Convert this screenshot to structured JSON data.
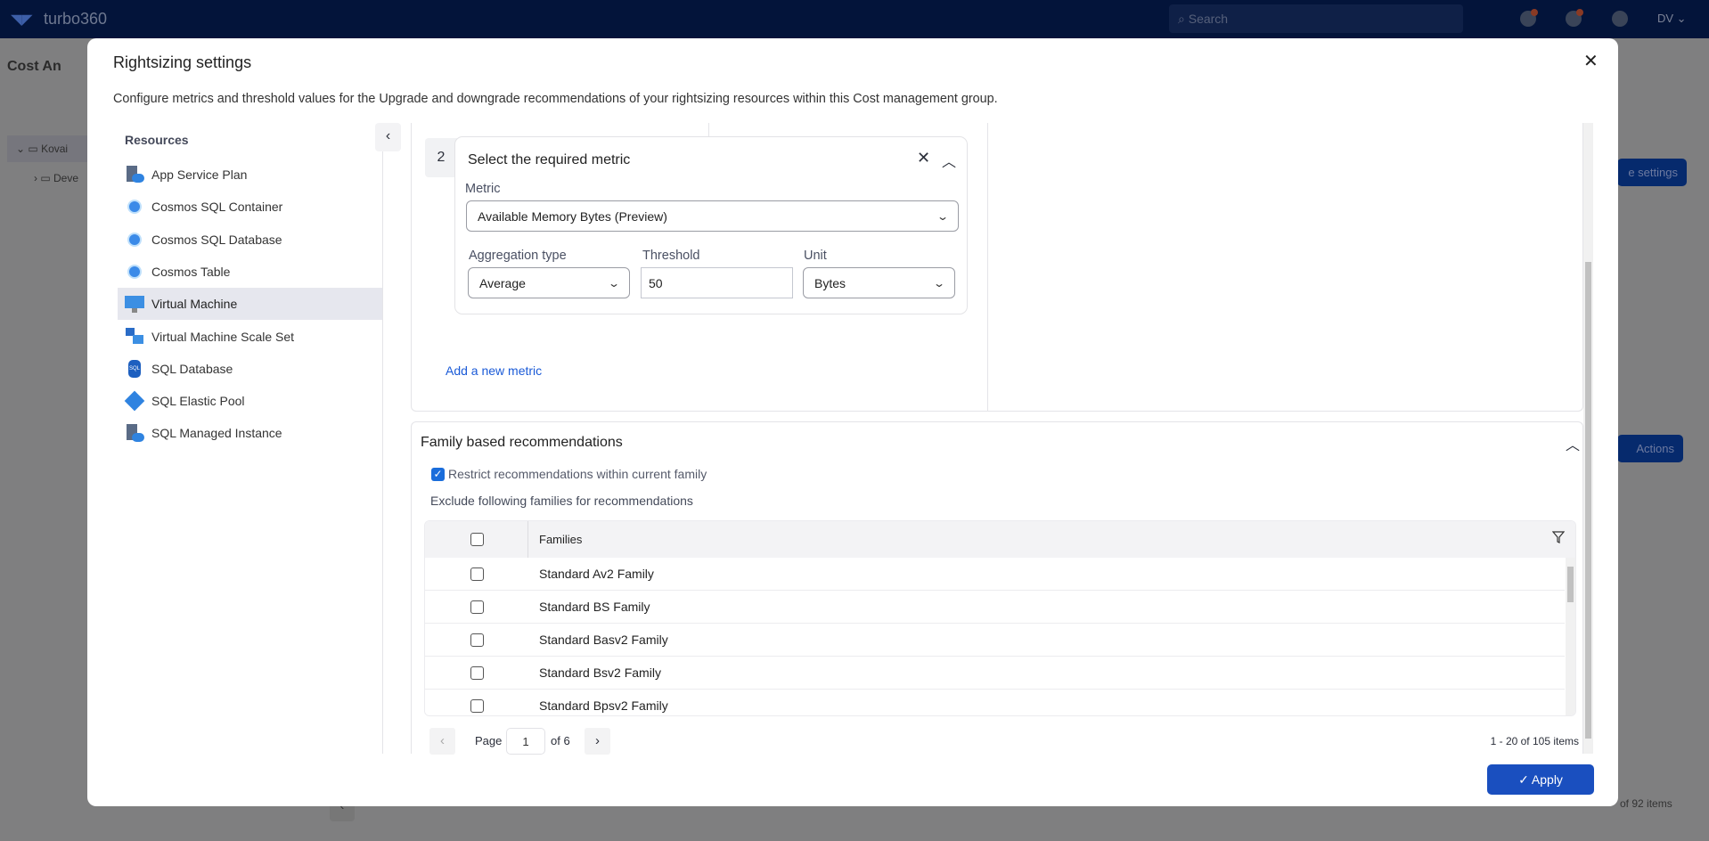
{
  "background": {
    "brand": "turbo360",
    "search_placeholder": "Search",
    "user_initials": "DV",
    "page_title": "Cost An",
    "tree": [
      "Kovai",
      "Deve"
    ],
    "settings_button": "e settings",
    "actions_button": "Actions",
    "items_count": "of 92 items"
  },
  "modal": {
    "title": "Rightsizing settings",
    "description": "Configure metrics and threshold values for the Upgrade and downgrade recommendations of your rightsizing resources within this Cost management group.",
    "resources_label": "Resources",
    "resources": [
      {
        "label": "App Service Plan",
        "icon": "app-service-plan-icon"
      },
      {
        "label": "Cosmos SQL Container",
        "icon": "cosmos-db-icon"
      },
      {
        "label": "Cosmos SQL Database",
        "icon": "cosmos-db-icon"
      },
      {
        "label": "Cosmos Table",
        "icon": "cosmos-db-icon"
      },
      {
        "label": "Virtual Machine",
        "icon": "virtual-machine-icon",
        "selected": true
      },
      {
        "label": "Virtual Machine Scale Set",
        "icon": "vm-scale-set-icon"
      },
      {
        "label": "SQL Database",
        "icon": "sql-database-icon"
      },
      {
        "label": "SQL Elastic Pool",
        "icon": "sql-elastic-pool-icon"
      },
      {
        "label": "SQL Managed Instance",
        "icon": "sql-managed-instance-icon"
      }
    ],
    "metric_card": {
      "step": "2",
      "title": "Select the required metric",
      "metric_label": "Metric",
      "metric_value": "Available Memory Bytes (Preview)",
      "aggregation_label": "Aggregation type",
      "aggregation_value": "Average",
      "threshold_label": "Threshold",
      "threshold_value": "50",
      "unit_label": "Unit",
      "unit_value": "Bytes"
    },
    "add_metric": "Add a new metric",
    "family": {
      "title": "Family based recommendations",
      "restrict_label": "Restrict recommendations within current family",
      "restrict_checked": true,
      "exclude_label": "Exclude following families for recommendations",
      "column_header": "Families",
      "rows": [
        "Standard Av2 Family",
        "Standard BS Family",
        "Standard Basv2 Family",
        "Standard Bsv2 Family",
        "Standard Bpsv2 Family"
      ],
      "page_label": "Page",
      "page_value": "1",
      "page_of": "of 6",
      "items_count": "1 - 20 of 105 items"
    },
    "apply_label": "✓ Apply"
  },
  "colors": {
    "accent": "#1a4fbf",
    "link": "#1a5ad7",
    "selected_bg": "#e6e7ee",
    "nav": "#03143a"
  }
}
